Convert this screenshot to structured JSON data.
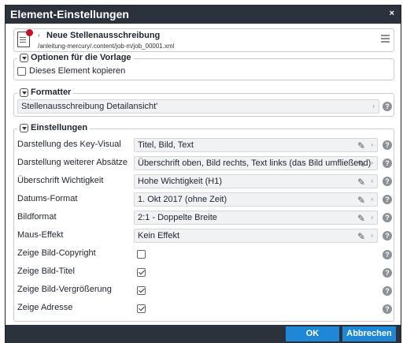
{
  "dialog": {
    "title": "Element-Einstellungen",
    "close_glyph": "×"
  },
  "resource": {
    "arrow": "›",
    "title": "Neue Stellenausschreibung",
    "path": "/anleitung-mercury/.content/job-m/job_00001.xml",
    "icon": "document-icon",
    "status_color": "#c0142a"
  },
  "sections": {
    "options": {
      "legend": "Optionen für die Vorlage",
      "copy_label": "Dieses Element kopieren",
      "copy_checked": false
    },
    "formatter": {
      "legend": "Formatter",
      "value": "Stellenausschreibung Detailansicht'"
    },
    "settings": {
      "legend": "Einstellungen",
      "rows": [
        {
          "label": "Darstellung des Key-Visual",
          "value": "Titel, Bild, Text"
        },
        {
          "label": "Darstellung weiterer Absätze",
          "value": "Überschrift oben, Bild rechts, Text links (das Bild umfließend)"
        },
        {
          "label": "Überschrift Wichtigkeit",
          "value": "Hohe Wichtigkeit (H1)"
        },
        {
          "label": "Datums-Format",
          "value": "1. Okt 2017 (ohne Zeit)"
        },
        {
          "label": "Bildformat",
          "value": "2:1 - Doppelte Breite"
        },
        {
          "label": "Maus-Effekt",
          "value": "Kein Effekt"
        }
      ],
      "checks": [
        {
          "label": "Zeige Bild-Copyright",
          "checked": false
        },
        {
          "label": "Zeige Bild-Titel",
          "checked": true
        },
        {
          "label": "Zeige Bild-Vergrößerung",
          "checked": true
        },
        {
          "label": "Zeige Adresse",
          "checked": true
        }
      ]
    }
  },
  "glyphs": {
    "help": "?",
    "chevron": "›",
    "pencil": "✎"
  },
  "footer": {
    "ok_label": "OK",
    "cancel_label": "Abbrechen"
  },
  "colors": {
    "titlebar": "#2b323c",
    "button": "#1e88d6"
  }
}
